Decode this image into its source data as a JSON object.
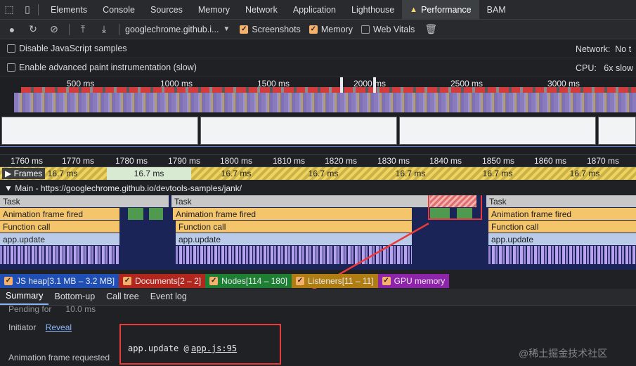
{
  "tabbar": {
    "tabs": [
      "Elements",
      "Console",
      "Sources",
      "Memory",
      "Network",
      "Application",
      "Lighthouse",
      "Performance",
      "BAM"
    ],
    "active": "Performance"
  },
  "toolbar": {
    "profile": "googlechrome.github.i...",
    "checkboxes": [
      {
        "label": "Screenshots",
        "checked": true
      },
      {
        "label": "Memory",
        "checked": true
      },
      {
        "label": "Web Vitals",
        "checked": false
      }
    ]
  },
  "settings": {
    "disable_js": "Disable JavaScript samples",
    "adv_paint": "Enable advanced paint instrumentation (slow)",
    "network_label": "Network:",
    "network_value": "No t",
    "cpu_label": "CPU:",
    "cpu_value": "6x slow"
  },
  "overview": {
    "labels": [
      "500 ms",
      "1000 ms",
      "1500 ms",
      "2000 ms",
      "2500 ms",
      "3000 ms"
    ]
  },
  "ruler": {
    "ticks": [
      "1760 ms",
      "1770 ms",
      "1780 ms",
      "1790 ms",
      "1800 ms",
      "1810 ms",
      "1820 ms",
      "1830 ms",
      "1840 ms",
      "1850 ms",
      "1860 ms",
      "1870 ms"
    ]
  },
  "frames": {
    "label": "Frames",
    "durations": [
      "16.7 ms",
      "16.7 ms",
      "16.7 ms",
      "16.7 ms",
      "16.7 ms",
      "16.7 ms",
      "16.7 ms"
    ]
  },
  "main": {
    "title": "Main - https://googlechrome.github.io/devtools-samples/jank/",
    "task": "Task",
    "anim": "Animation frame fired",
    "func": "Function call",
    "update": "app.update"
  },
  "counters": [
    {
      "label": "JS heap[3.1 MB – 3.2 MB]",
      "color": "#1f4fb5"
    },
    {
      "label": "Documents[2 – 2]",
      "color": "#b3261e"
    },
    {
      "label": "Nodes[114 – 180]",
      "color": "#1e7e34"
    },
    {
      "label": "Listeners[11 – 11]",
      "color": "#b07d12"
    },
    {
      "label": "GPU memory",
      "color": "#8e24aa"
    }
  ],
  "bottom_tabs": [
    "Summary",
    "Bottom-up",
    "Call tree",
    "Event log"
  ],
  "summary": {
    "pending_label": "Pending for",
    "pending_value": "10.0 ms",
    "initiator_label": "Initiator",
    "initiator_link": "Reveal",
    "anim_req_label": "Animation frame requested",
    "func_name": "app.update @",
    "file_link": "app.js:95"
  },
  "watermark": "@稀土掘金技术社区"
}
